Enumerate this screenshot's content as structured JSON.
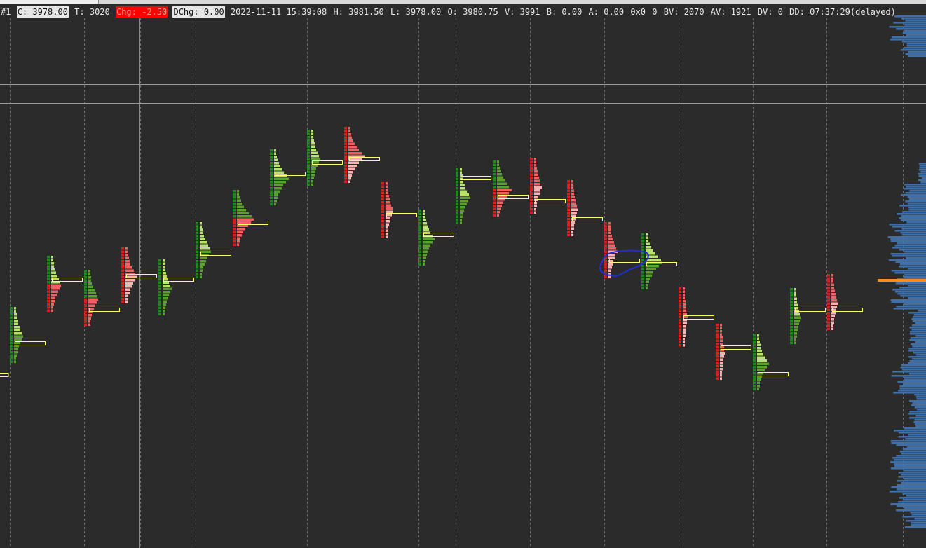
{
  "header": {
    "chart_number": "#1",
    "close": "C: 3978.00",
    "ticks": "T: 3020",
    "change": "Chg: -2.50",
    "daily_change": "DChg: 0.00",
    "datetime": "2022-11-11 15:39:08",
    "high": "H: 3981.50",
    "low": "L: 3978.00",
    "open": "O: 3980.75",
    "volume": "V: 3991",
    "bid": "B: 0.00",
    "ask": "A: 0.00",
    "bid_ask_size": "0x0",
    "zero": "0",
    "bid_volume": "BV: 2070",
    "ask_volume": "AV: 1921",
    "delta_volume": "DV: 0",
    "countdown": "DD: 07:37:29(delayed)"
  },
  "colors": {
    "background": "#2b2b2b",
    "strong_buy": "#1a8a1a",
    "buy": "#5aa02c",
    "light_buy": "#b7e36d",
    "strong_sell": "#e01b1b",
    "sell": "#f06262",
    "light_sell": "#ffb0b0",
    "poc_outline": "#ffff66",
    "volume_profile": "#3f6fa8",
    "current_price_line": "#ff8c1a",
    "annotation": "#1f2fd0"
  }
}
